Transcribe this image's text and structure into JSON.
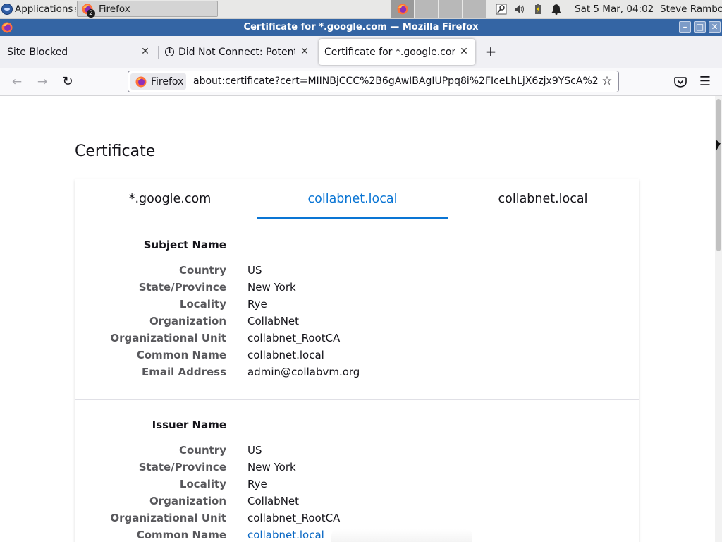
{
  "panel": {
    "applications_label": "Applications",
    "applications_sep": "⁝",
    "task_label": "Firefox",
    "task_badge": "2",
    "clock": "Sat  5 Mar, 04:02",
    "user": "Steve Rambo"
  },
  "window": {
    "title": "Certificate for *.google.com — Mozilla Firefox"
  },
  "tabs": [
    {
      "label": "Site Blocked"
    },
    {
      "label": "Did Not Connect: Potential Security Issue"
    },
    {
      "label": "Certificate for *.google.com"
    }
  ],
  "toolbar": {
    "identity_label": "Firefox",
    "url": "about:certificate?cert=MIINBjCCC%2B6gAwIBAgIUPpq8i%2FIceLhLjX6zjx9YScA%2"
  },
  "page": {
    "title": "Certificate",
    "cert_tabs": [
      "*.google.com",
      "collabnet.local",
      "collabnet.local"
    ],
    "subject": {
      "heading": "Subject Name",
      "rows": [
        {
          "k": "Country",
          "v": "US"
        },
        {
          "k": "State/Province",
          "v": "New York"
        },
        {
          "k": "Locality",
          "v": "Rye"
        },
        {
          "k": "Organization",
          "v": "CollabNet"
        },
        {
          "k": "Organizational Unit",
          "v": "collabnet_RootCA"
        },
        {
          "k": "Common Name",
          "v": "collabnet.local"
        },
        {
          "k": "Email Address",
          "v": "admin@collabvm.org"
        }
      ]
    },
    "issuer": {
      "heading": "Issuer Name",
      "rows": [
        {
          "k": "Country",
          "v": "US"
        },
        {
          "k": "State/Province",
          "v": "New York"
        },
        {
          "k": "Locality",
          "v": "Rye"
        },
        {
          "k": "Organization",
          "v": "CollabNet"
        },
        {
          "k": "Organizational Unit",
          "v": "collabnet_RootCA"
        },
        {
          "k": "Common Name",
          "v": "collabnet.local"
        }
      ]
    }
  },
  "colors": {
    "titlebar": "#3465a4",
    "accent": "#0a75d4",
    "link": "#0a68c4"
  },
  "icons": [
    "firefox-icon",
    "close-icon",
    "info-icon",
    "plus-icon",
    "back-icon",
    "forward-icon",
    "reload-icon",
    "star-icon",
    "pocket-icon",
    "menu-icon",
    "volume-icon",
    "bell-icon",
    "search-icon",
    "battery-icon"
  ]
}
